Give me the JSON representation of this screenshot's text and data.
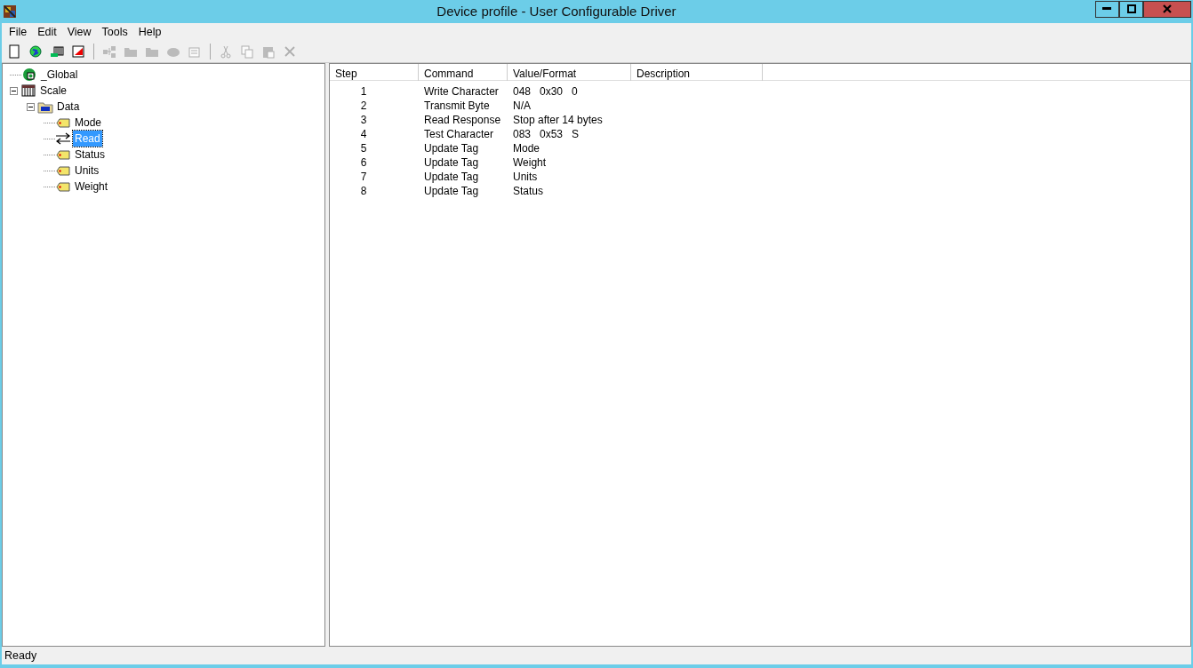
{
  "window": {
    "title": "Device profile - User Configurable Driver"
  },
  "menu": [
    {
      "label": "File"
    },
    {
      "label": "Edit"
    },
    {
      "label": "View"
    },
    {
      "label": "Tools"
    },
    {
      "label": "Help"
    }
  ],
  "toolbar": [
    {
      "kind": "new",
      "disabled": false
    },
    {
      "kind": "globe",
      "disabled": false
    },
    {
      "kind": "device",
      "disabled": false
    },
    {
      "kind": "check",
      "disabled": false
    },
    {
      "kind": "sep"
    },
    {
      "kind": "tree",
      "disabled": true
    },
    {
      "kind": "folder",
      "disabled": true
    },
    {
      "kind": "folder",
      "disabled": true
    },
    {
      "kind": "tag",
      "disabled": true
    },
    {
      "kind": "props",
      "disabled": true
    },
    {
      "kind": "sep"
    },
    {
      "kind": "cut",
      "disabled": true
    },
    {
      "kind": "copy",
      "disabled": true
    },
    {
      "kind": "paste",
      "disabled": true
    },
    {
      "kind": "delete",
      "disabled": true
    }
  ],
  "tree": [
    {
      "label": "_Global",
      "kind": "global",
      "selected": false
    },
    {
      "label": "Scale",
      "kind": "device",
      "selected": false,
      "expanded": true,
      "children": [
        {
          "label": "Data",
          "kind": "folder",
          "selected": false,
          "expanded": true,
          "children": [
            {
              "label": "Mode",
              "kind": "tag",
              "selected": false
            },
            {
              "label": "Read",
              "kind": "transaction",
              "selected": true
            },
            {
              "label": "Status",
              "kind": "tag",
              "selected": false
            },
            {
              "label": "Units",
              "kind": "tag",
              "selected": false
            },
            {
              "label": "Weight",
              "kind": "tag",
              "selected": false
            }
          ]
        }
      ]
    }
  ],
  "table": {
    "columns": [
      "Step",
      "Command",
      "Value/Format",
      "Description"
    ],
    "rows": [
      [
        "1",
        "Write Character",
        "048   0x30   0"
      ],
      [
        "2",
        "Transmit Byte",
        "N/A"
      ],
      [
        "3",
        "Read Response",
        "Stop after 14 bytes"
      ],
      [
        "4",
        "Test Character",
        "083   0x53   S"
      ],
      [
        "5",
        "Update Tag",
        "Mode"
      ],
      [
        "6",
        "Update Tag",
        "Weight"
      ],
      [
        "7",
        "Update Tag",
        "Units"
      ],
      [
        "8",
        "Update Tag",
        "Status"
      ]
    ]
  },
  "status_bar": "Ready"
}
